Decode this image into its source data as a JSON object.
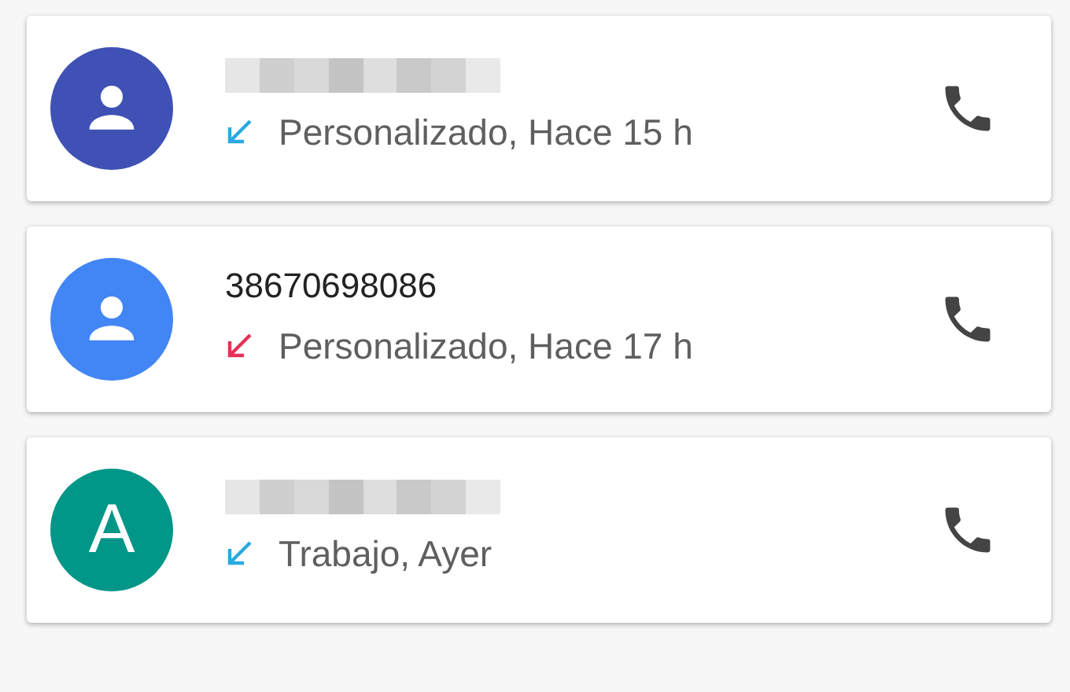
{
  "calls": [
    {
      "avatar": {
        "kind": "person",
        "color": "#3f51b5"
      },
      "name_hidden": true,
      "missed": false,
      "detail": "Personalizado, Hace 15 h"
    },
    {
      "avatar": {
        "kind": "person",
        "color": "#4285f4"
      },
      "name_hidden": false,
      "name": "38670698086",
      "missed": true,
      "detail": "Personalizado, Hace 17 h"
    },
    {
      "avatar": {
        "kind": "letter",
        "color": "#009688",
        "letter": "A"
      },
      "name_hidden": true,
      "missed": false,
      "detail": "Trabajo, Ayer"
    }
  ]
}
